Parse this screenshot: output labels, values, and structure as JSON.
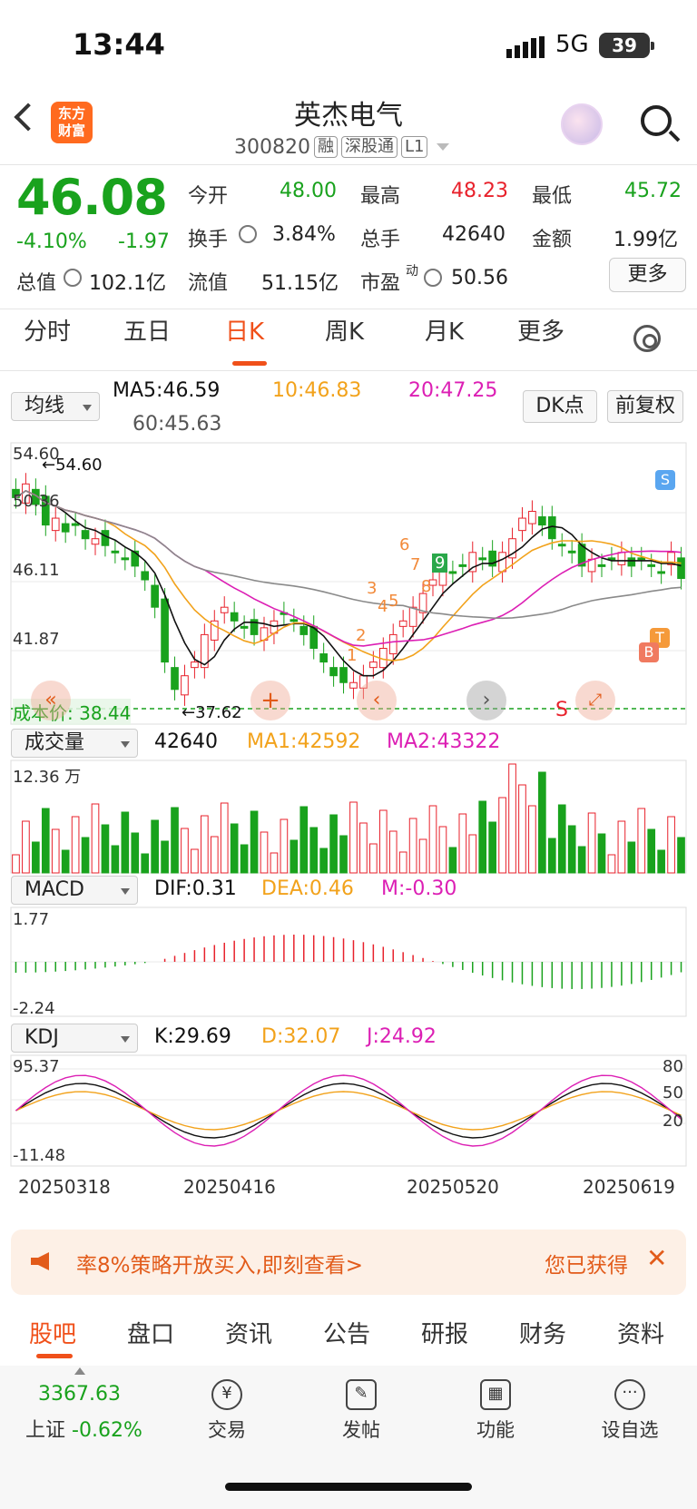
{
  "status": {
    "time": "13:44",
    "network": "5G",
    "battery": "39"
  },
  "header": {
    "logo_text": "东方\n财富",
    "stock_name": "英杰电气",
    "code": "300820",
    "tags": [
      "融",
      "深股通",
      "L1"
    ]
  },
  "quote": {
    "price": "46.08",
    "change_pct": "-4.10%",
    "change": "-1.97",
    "open_label": "今开",
    "open": "48.00",
    "high_label": "最高",
    "high": "48.23",
    "low_label": "最低",
    "low": "45.72",
    "turnover_label": "换手",
    "turnover": "3.84%",
    "volume_label": "总手",
    "volume": "42640",
    "amount_label": "金额",
    "amount": "1.99亿",
    "mcap_label": "总值",
    "mcap": "102.1亿",
    "float_label": "流值",
    "float": "51.15亿",
    "pe_label": "市盈",
    "pe_sup": "动",
    "pe": "50.56",
    "more": "更多"
  },
  "tabs": [
    {
      "label": "分时"
    },
    {
      "label": "五日"
    },
    {
      "label": "日K"
    },
    {
      "label": "周K"
    },
    {
      "label": "月K"
    },
    {
      "label": "更多"
    }
  ],
  "kline": {
    "ma_selector": "均线",
    "ma5": "MA5:46.59",
    "ma10": "10:46.83",
    "ma20": "20:47.25",
    "ma60": "60:45.63",
    "dk_button": "DK点",
    "adjust_button": "前复权",
    "y_labels": [
      "54.60",
      "50.36",
      "46.11",
      "41.87"
    ],
    "high_marker": "54.60",
    "low_marker": "37.62",
    "cost_line_label": "成本价: 38.44",
    "numbers": [
      "1",
      "2",
      "3",
      "4",
      "5",
      "6",
      "7",
      "8",
      "9"
    ],
    "signals": {
      "s": "S",
      "t": "T",
      "b": "B",
      "s2": "S"
    }
  },
  "volume": {
    "selector": "成交量",
    "value": "42640",
    "ma1": "MA1:42592",
    "ma2": "MA2:43322",
    "max": "12.36 万"
  },
  "macd": {
    "selector": "MACD",
    "dif": "DIF:0.31",
    "dea": "DEA:0.46",
    "m": "M:-0.30",
    "top": "1.77",
    "bottom": "-2.24"
  },
  "kdj": {
    "selector": "KDJ",
    "k": "K:29.69",
    "d": "D:32.07",
    "j": "J:24.92",
    "top": "95.37",
    "bottom": "-11.48",
    "levels": [
      "80",
      "50",
      "20"
    ]
  },
  "dates": [
    "20250318",
    "20250416",
    "20250520",
    "20250619"
  ],
  "banner": {
    "text": "率8%策略开放买入,即刻查看>",
    "right": "您已获得"
  },
  "bottom_tabs": [
    {
      "label": "股吧"
    },
    {
      "label": "盘口"
    },
    {
      "label": "资讯"
    },
    {
      "label": "公告"
    },
    {
      "label": "研报"
    },
    {
      "label": "财务"
    },
    {
      "label": "资料"
    }
  ],
  "dock": {
    "index_value": "3367.63",
    "index_name": "上证",
    "index_change": "-0.62%",
    "items": [
      {
        "label": "交易"
      },
      {
        "label": "发帖"
      },
      {
        "label": "功能"
      },
      {
        "label": "设自选"
      }
    ]
  },
  "colors": {
    "up": "#e8212b",
    "down": "#19a21d",
    "ma5": "#111111",
    "ma10": "#f2a21b",
    "ma20": "#dc1fb4",
    "ma60": "#8a8a8a",
    "accent": "#f0501a"
  }
}
